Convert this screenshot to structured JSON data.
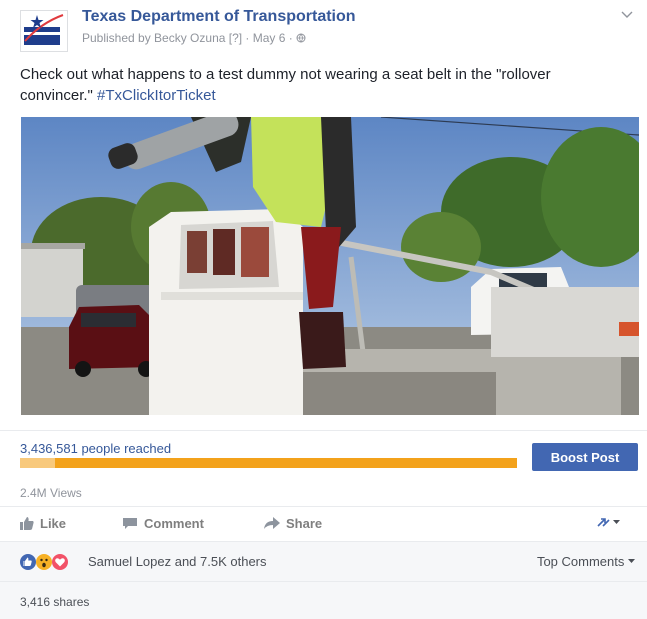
{
  "post": {
    "page_name": "Texas Department of Transportation",
    "meta": "Published by Becky Ozuna [?] · May 6 · ",
    "text_main": "Check out what happens to a test dummy not wearing a seat belt in the \"rollover convincer.\" ",
    "hashtag": "#TxClickItorTicket"
  },
  "stats": {
    "reach_label": "3,436,581 people reached",
    "reach_organic_fraction": 0.07,
    "boost_label": "Boost Post",
    "views": "2.4M Views"
  },
  "actions": {
    "like": "Like",
    "comment": "Comment",
    "share": "Share"
  },
  "reactions": {
    "names": "Samuel Lopez and 7.5K others",
    "top_comments": "Top Comments"
  },
  "shares": "3,416 shares",
  "colors": {
    "link": "#365899",
    "boost": "#4267b2",
    "reach_bar": "#f3a21b",
    "like_reaction": "#4267b2",
    "wow_reaction": "#f7b125",
    "love_reaction": "#f25268"
  }
}
